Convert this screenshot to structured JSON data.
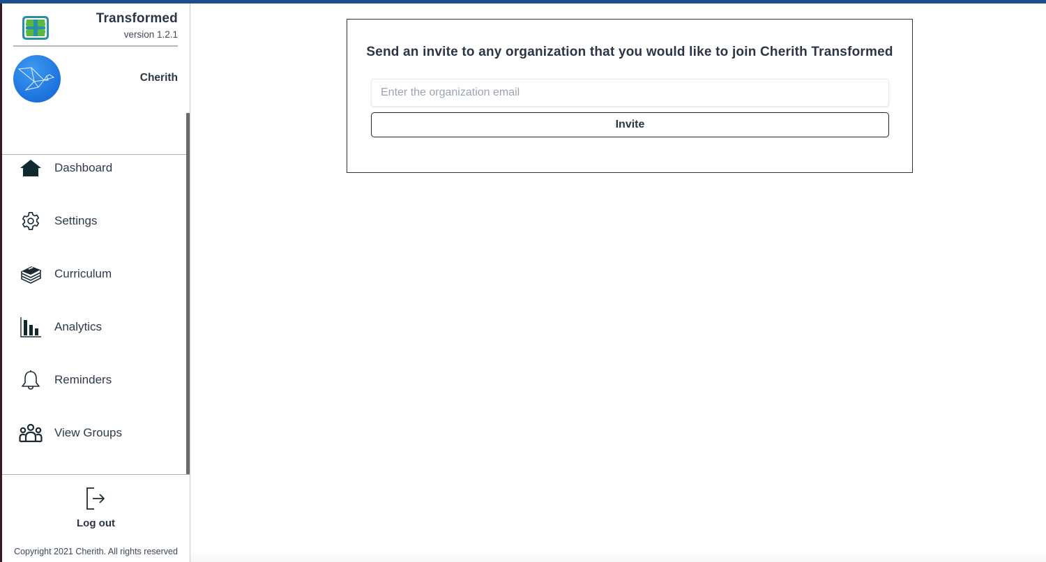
{
  "app": {
    "title": "Transformed",
    "version": "version 1.2.1",
    "accent_color": "#1c4f8f"
  },
  "profile": {
    "name": "Cherith",
    "avatar_icon": "origami-bird-icon"
  },
  "sidebar": {
    "items": [
      {
        "label": "Dashboard",
        "icon": "home-icon"
      },
      {
        "label": "Settings",
        "icon": "gear-icon"
      },
      {
        "label": "Curriculum",
        "icon": "books-icon"
      },
      {
        "label": "Analytics",
        "icon": "bar-chart-icon"
      },
      {
        "label": "Reminders",
        "icon": "bell-icon"
      },
      {
        "label": "View Groups",
        "icon": "users-group-icon"
      }
    ],
    "logout_label": "Log out",
    "logout_icon": "logout-icon",
    "copyright": "Copyright 2021 Cherith. All rights reserved"
  },
  "invite": {
    "title": "Send an invite to any organization that you would like to join Cherith Transformed",
    "email_placeholder": "Enter the organization email",
    "email_value": "",
    "button_label": "Invite"
  }
}
